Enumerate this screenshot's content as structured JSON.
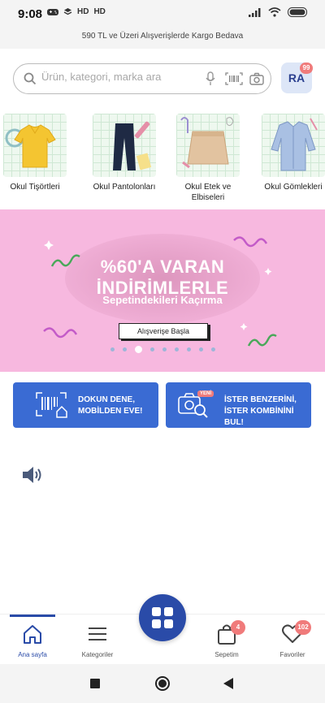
{
  "status_bar": {
    "time": "9:08",
    "left_icons": [
      "game-icon",
      "layers-icon",
      "HD",
      "HD"
    ],
    "right_icons": [
      "signal-icon",
      "wifi-icon",
      "battery-icon"
    ]
  },
  "promo_strip": {
    "text": "590 TL ve Üzeri Alışverişlerde Kargo Bedava"
  },
  "search": {
    "placeholder": "Ürün, kategori, marka ara"
  },
  "avatar": {
    "initials": "RA",
    "badge": "99"
  },
  "categories": [
    {
      "label": "Okul Tişörtleri",
      "icon": "yellow-tshirt"
    },
    {
      "label": "Okul Pantolonları",
      "icon": "navy-trousers"
    },
    {
      "label": "Okul Etek ve Elbiseleri",
      "icon": "beige-skirt"
    },
    {
      "label": "Okul Gömlekleri",
      "icon": "blue-shirt"
    }
  ],
  "banner": {
    "line1": "%60'A VARAN",
    "line2": "İNDİRİMLERLE",
    "line3": "Sepetindekileri Kaçırma",
    "button": "Alışverişe Başla",
    "slide_count": 9,
    "active_slide": 3
  },
  "features": [
    {
      "line1": "DOKUN DENE,",
      "line2": "MOBİLDEN EVE!",
      "icon": "barcode-house-icon"
    },
    {
      "line1": "İSTER BENZERİNİ,",
      "line2": "İSTER KOMBİNİNİ BUL!",
      "icon": "camera-search-icon",
      "badge": "YENİ"
    }
  ],
  "bottom_nav": {
    "items": [
      {
        "label": "Ana sayfa",
        "icon": "home-icon",
        "active": true
      },
      {
        "label": "Kategoriler",
        "icon": "menu-icon"
      },
      {
        "label": "Sepetim",
        "icon": "bag-icon",
        "badge": "4"
      },
      {
        "label": "Favoriler",
        "icon": "heart-icon",
        "badge": "102"
      }
    ],
    "center_button_icon": "grid-icon"
  },
  "colors": {
    "brand": "#2a4ba8",
    "feature_blue": "#3a6bd3",
    "banner_pink": "#f7b8df",
    "badge_red": "#f07b7b"
  }
}
